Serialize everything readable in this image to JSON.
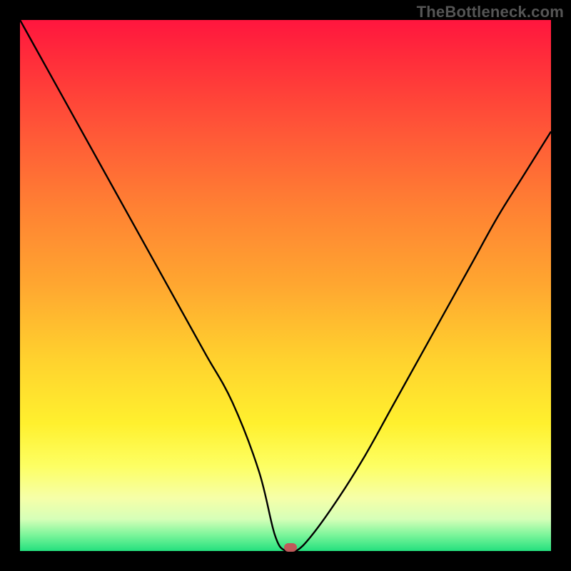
{
  "watermark": "TheBottleneck.com",
  "colors": {
    "marker": "#c05a5a",
    "curve_stroke": "#000000"
  },
  "chart_data": {
    "type": "line",
    "title": "",
    "xlabel": "",
    "ylabel": "",
    "xlim": [
      0,
      100
    ],
    "ylim": [
      0,
      100
    ],
    "grid": false,
    "legend": null,
    "series": [
      {
        "name": "bottleneck-curve",
        "x": [
          0,
          5,
          10,
          15,
          20,
          25,
          30,
          35,
          40,
          45,
          48,
          50,
          52,
          55,
          60,
          65,
          70,
          75,
          80,
          85,
          90,
          95,
          100
        ],
        "y": [
          100,
          91,
          82,
          73,
          64,
          55,
          46,
          37,
          28,
          15,
          3,
          0,
          0,
          3,
          10,
          18,
          27,
          36,
          45,
          54,
          63,
          71,
          79
        ]
      }
    ],
    "annotations": [
      {
        "name": "selected-marker",
        "x": 51,
        "y": 0.7
      }
    ],
    "background_gradient_stops": [
      {
        "pos": 0,
        "color": "#ff163e"
      },
      {
        "pos": 50,
        "color": "#ffa730"
      },
      {
        "pos": 80,
        "color": "#fdff63"
      },
      {
        "pos": 100,
        "color": "#24e07e"
      }
    ]
  }
}
